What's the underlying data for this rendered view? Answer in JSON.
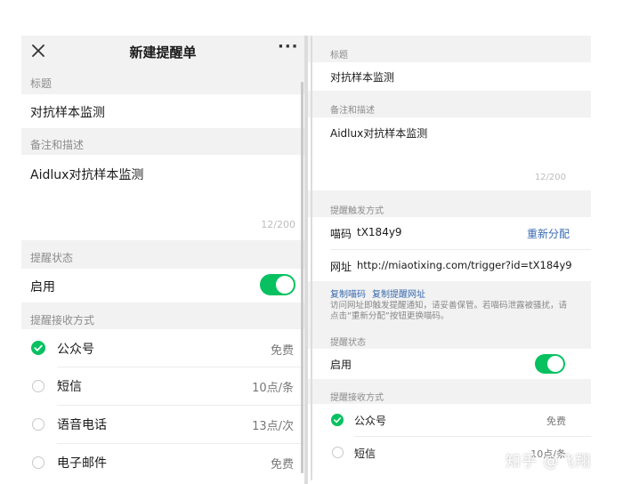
{
  "left": {
    "header": {
      "title": "新建提醒单",
      "close_icon": "close-icon",
      "more_icon": "more-icon"
    },
    "title_label": "标题",
    "title_value": "对抗样本监测",
    "desc_label": "备注和描述",
    "desc_value": "Aidlux对抗样本监测",
    "counter": "12/200",
    "status_label": "提醒状态",
    "enabled_label": "启用",
    "enabled_on": true,
    "receive_label": "提醒接收方式",
    "methods": [
      {
        "name": "公众号",
        "price": "免费",
        "checked": true
      },
      {
        "name": "短信",
        "price": "10点/条",
        "checked": false
      },
      {
        "name": "语音电话",
        "price": "13点/次",
        "checked": false
      },
      {
        "name": "电子邮件",
        "price": "免费",
        "checked": false
      }
    ]
  },
  "right": {
    "title_label": "标题",
    "title_value": "对抗样本监测",
    "desc_label": "备注和描述",
    "desc_value": "Aidlux对抗样本监测",
    "counter": "12/200",
    "trigger_label": "提醒触发方式",
    "code_label": "喵码",
    "code_value": "tX184y9",
    "reassign": "重新分配",
    "url_label": "网址",
    "url_value": "http://miaotixing.com/trigger?id=tX184y9",
    "copy_code": "复制喵码",
    "copy_url": "复制提醒网址",
    "note": "访问网址即触发提醒通知，请妥善保管。若喵码泄露被骚扰，请点击“重新分配”按钮更换喵码。",
    "status_label": "提醒状态",
    "enabled_label": "启用",
    "enabled_on": true,
    "receive_label": "提醒接收方式",
    "methods": [
      {
        "name": "公众号",
        "price": "免费",
        "checked": true
      },
      {
        "name": "短信",
        "price": "10点/条",
        "checked": false
      }
    ]
  },
  "watermark": "知乎 @飞翔",
  "colors": {
    "accent": "#07c160",
    "link": "#3a6bb0",
    "background": "#f2f2f2"
  }
}
